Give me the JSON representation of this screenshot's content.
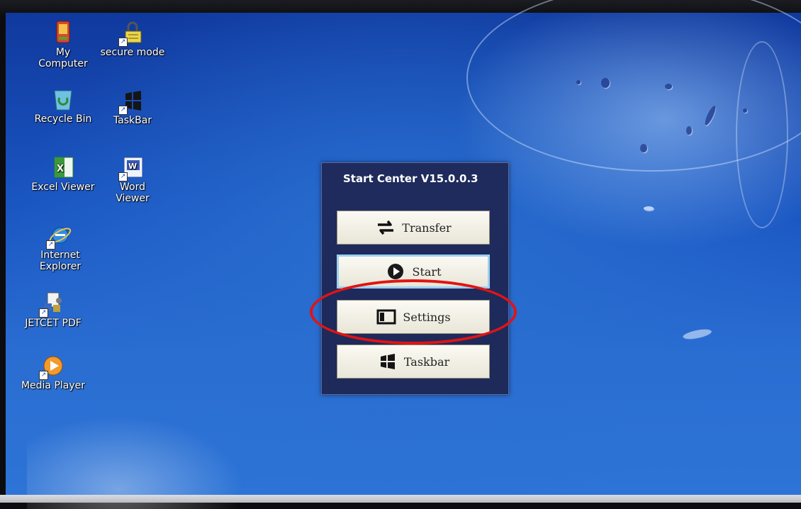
{
  "desktop": {
    "icons": [
      {
        "label": "My\nComputer",
        "icon": "computer-icon"
      },
      {
        "label": "secure mode",
        "icon": "secure-mode-icon"
      },
      {
        "label": "Recycle Bin",
        "icon": "recycle-bin-icon"
      },
      {
        "label": "TaskBar",
        "icon": "windows-logo-icon"
      },
      {
        "label": "Excel Viewer",
        "icon": "excel-icon"
      },
      {
        "label": "Word\nViewer",
        "icon": "word-icon"
      },
      {
        "label": "Internet\nExplorer",
        "icon": "internet-explorer-icon"
      },
      {
        "label": "JETCET PDF",
        "icon": "pdf-icon"
      },
      {
        "label": "Media Player",
        "icon": "media-player-icon"
      }
    ]
  },
  "start_center": {
    "title": "Start Center V15.0.0.3",
    "buttons": [
      {
        "label": "Transfer",
        "icon": "transfer-arrows-icon"
      },
      {
        "label": "Start",
        "icon": "play-icon"
      },
      {
        "label": "Settings",
        "icon": "settings-window-icon"
      },
      {
        "label": "Taskbar",
        "icon": "windows-logo-icon"
      }
    ]
  },
  "annotation": {
    "color": "#e01414",
    "target": "Settings"
  }
}
